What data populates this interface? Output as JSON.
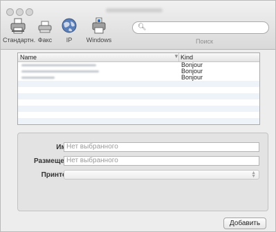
{
  "toolbar": {
    "tools": [
      {
        "label": "Стандартн.",
        "icon": "printer-default-icon"
      },
      {
        "label": "Факс",
        "icon": "fax-icon"
      },
      {
        "label": "IP",
        "icon": "globe-icon"
      },
      {
        "label": "Windows",
        "icon": "windows-printer-icon"
      }
    ],
    "search_placeholder": "",
    "search_label": "Поиск"
  },
  "table": {
    "headers": {
      "name": "Name",
      "kind": "Kind"
    },
    "rows": [
      {
        "kind": "Bonjour"
      },
      {
        "kind": "Bonjour"
      },
      {
        "kind": "Bonjour"
      }
    ]
  },
  "form": {
    "name_label": "Имя:",
    "name_value": "Нет выбранного",
    "location_label": "Размещен.:",
    "location_value": "Нет выбранного",
    "printer_label": "Принтер:"
  },
  "add_button_label": "Добавить"
}
